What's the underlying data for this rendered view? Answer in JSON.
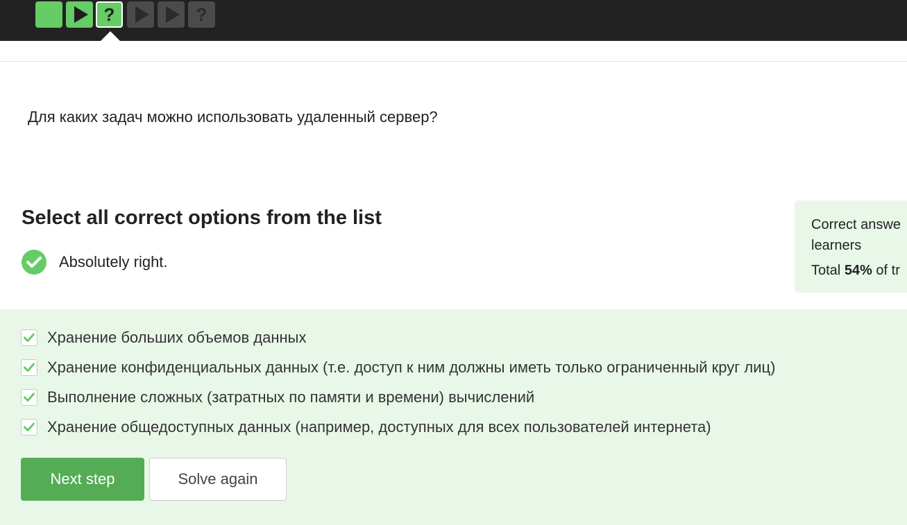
{
  "step_bar": {
    "steps": [
      {
        "type": "text",
        "status": "passed"
      },
      {
        "type": "video",
        "status": "passed"
      },
      {
        "type": "quiz",
        "status": "passed",
        "current": true,
        "glyph": "?"
      },
      {
        "type": "video",
        "status": "not-started"
      },
      {
        "type": "video",
        "status": "not-started"
      },
      {
        "type": "quiz",
        "status": "not-started",
        "glyph": "?"
      }
    ]
  },
  "question": {
    "text": "Для каких задач можно использовать удаленный сервер?"
  },
  "quiz": {
    "heading": "Select all correct options from the list",
    "status_text": "Absolutely right.",
    "status_icon": "check-circle-icon"
  },
  "stats": {
    "line1": "Correct answe",
    "line1b": "learners",
    "total_prefix": "Total ",
    "total_value": "54%",
    "total_suffix": " of tr"
  },
  "options": [
    {
      "label": "Хранение больших объемов данных",
      "checked": true
    },
    {
      "label": "Хранение конфиденциальных данных (т.е. доступ к ним должны иметь только ограниченный круг лиц)",
      "checked": true
    },
    {
      "label": "Выполнение сложных (затратных по памяти и времени) вычислений",
      "checked": true
    },
    {
      "label": "Хранение общедоступных данных (например, доступных для всех пользователей интернета)",
      "checked": true
    }
  ],
  "buttons": {
    "next": "Next step",
    "again": "Solve again"
  },
  "colors": {
    "accent": "#66cc66",
    "button_green": "#54ad54",
    "panel_bg": "#e9f7e9",
    "topbar": "#222222"
  }
}
